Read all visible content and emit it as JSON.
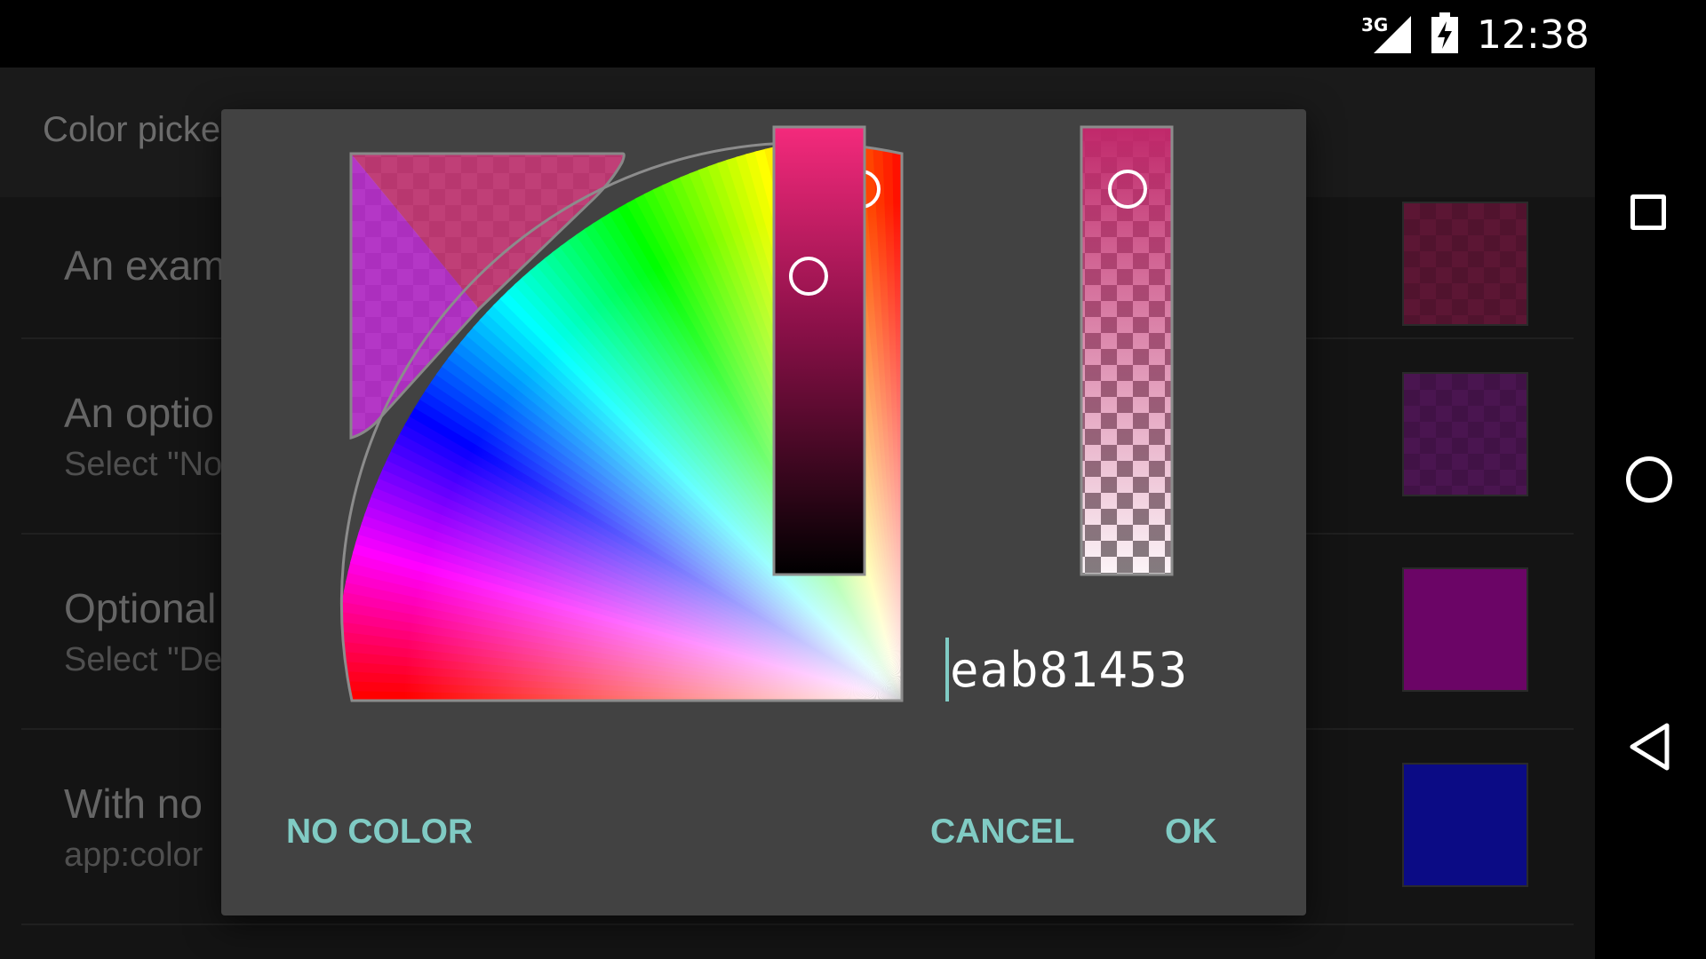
{
  "status_bar": {
    "network": "3G",
    "time": "12:38"
  },
  "app": {
    "title": "Color picke",
    "preferences": [
      {
        "title": "An exam",
        "subtitle": "",
        "color": "#5c1634"
      },
      {
        "title": "An optio",
        "subtitle": "Select \"No",
        "color": "#4a1550"
      },
      {
        "title": "Optional",
        "subtitle": "Select \"De",
        "color": "#6b0566"
      },
      {
        "title": "With no",
        "subtitle": "app:color",
        "color": "#0b0b85"
      }
    ]
  },
  "dialog": {
    "hex_value": "eab81453",
    "selected_color": "#eab814",
    "value_slider_color": "#f02a78",
    "alpha_color": "#c0286a",
    "buttons": {
      "no_color": "NO COLOR",
      "cancel": "CANCEL",
      "ok": "OK"
    },
    "accent": "#80cbc4"
  }
}
